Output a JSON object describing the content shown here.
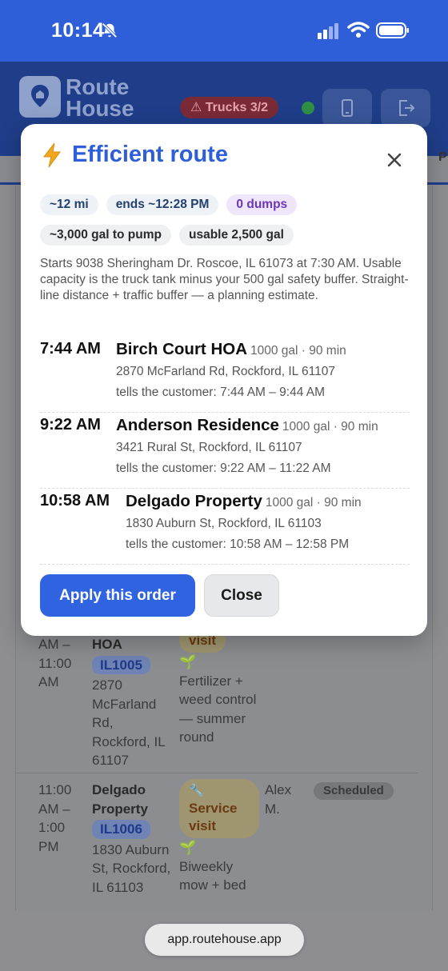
{
  "status_bar": {
    "time": "10:14"
  },
  "app_header": {
    "logo_line1": "Route",
    "logo_line2": "House",
    "trucks_badge": "⚠ Trucks 3/2",
    "tab_partial": "P"
  },
  "background_table": {
    "rows": [
      {
        "time_lines": [
          "AM –",
          "11:00",
          "AM"
        ],
        "name": "HOA",
        "id": "IL1005",
        "address": "2870 McFarland Rd, Rockford, IL 61107",
        "service_partial": "visit",
        "description": "Fertilizer + weed control — summer round"
      },
      {
        "time_head": "11:00",
        "time_lines": [
          "11:00",
          "AM –",
          "1:00",
          "PM"
        ],
        "name": "Delgado Property",
        "id": "IL1006",
        "address": "1830 Auburn St, Rockford, IL 61103",
        "service": "Service visit",
        "description": "Biweekly mow + bed",
        "tech": "Alex M.",
        "status": "Scheduled"
      }
    ]
  },
  "modal": {
    "title": "Efficient route",
    "chips_row1": [
      "~12 mi",
      "ends ~12:28 PM",
      "0 dumps"
    ],
    "chips_row2": [
      "~3,000 gal to pump",
      "usable 2,500 gal"
    ],
    "description": "Starts 9038 Sheringham Dr. Roscoe, IL 61073 at 7:30 AM. Usable capacity is the truck tank minus your 500 gal safety buffer. Straight-line distance + traffic buffer — a planning estimate.",
    "stops": [
      {
        "time": "7:44 AM",
        "name": "Birch Court HOA",
        "meta": "1000 gal · 90 min",
        "address": "2870 McFarland Rd, Rockford, IL 61107",
        "window": "tells the customer: 7:44 AM – 9:44 AM"
      },
      {
        "time": "9:22 AM",
        "name": "Anderson Residence",
        "meta": "1000 gal · 90 min",
        "address": "3421 Rural St, Rockford, IL 61107",
        "window": "tells the customer: 9:22 AM – 11:22 AM"
      },
      {
        "time": "10:58 AM",
        "name": "Delgado Property",
        "meta": "1000 gal · 90 min",
        "address": "1830 Auburn St, Rockford, IL 61103",
        "window": "tells the customer: 10:58 AM – 12:58 PM"
      }
    ],
    "apply_label": "Apply this order",
    "close_label": "Close"
  },
  "url_bar": {
    "url": "app.routehouse.app"
  },
  "colors": {
    "brand_blue": "#2f5fd8",
    "apply_button": "#2f63e0",
    "dumps_chip": "#6b36b8",
    "trucks_warning": "#d32f3f"
  }
}
